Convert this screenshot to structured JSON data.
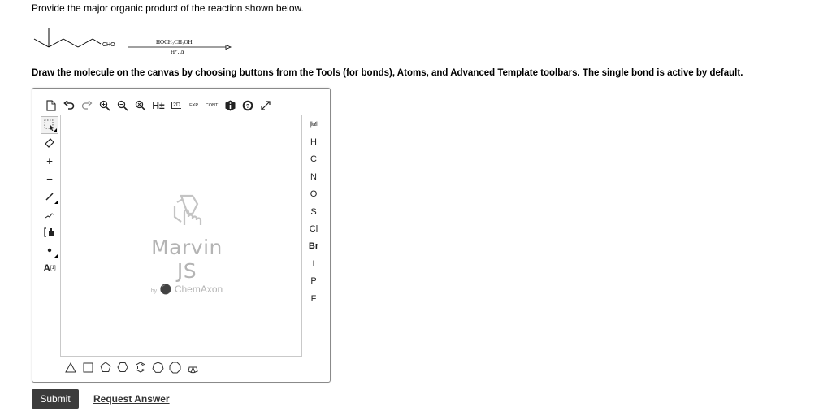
{
  "question": "Provide the major organic product of the reaction shown below.",
  "reaction": {
    "substituent": "CHO",
    "reagent": "HOCH₂CH₂OH",
    "conditions": "H⁺, Δ"
  },
  "instruction": "Draw the molecule on the canvas by choosing buttons from the Tools (for bonds), Atoms, and Advanced Template toolbars. The single bond is active by default.",
  "editor": {
    "top_toolbar": {
      "h_label": "H±",
      "clean2d_label": "2D",
      "expand_label": "EXP.",
      "contract_label": "CONT."
    },
    "left_toolbar": {
      "plus": "+",
      "minus": "−",
      "map_label": "[1]",
      "atom_label": "A"
    },
    "atoms": [
      "H",
      "C",
      "N",
      "O",
      "S",
      "Cl",
      "Br",
      "I",
      "P",
      "F"
    ],
    "periodic_label": "|lu!l",
    "logo": {
      "name": "Marvin JS",
      "by": "by",
      "company": "ChemAxon"
    }
  },
  "buttons": {
    "submit": "Submit",
    "request_answer": "Request Answer"
  }
}
